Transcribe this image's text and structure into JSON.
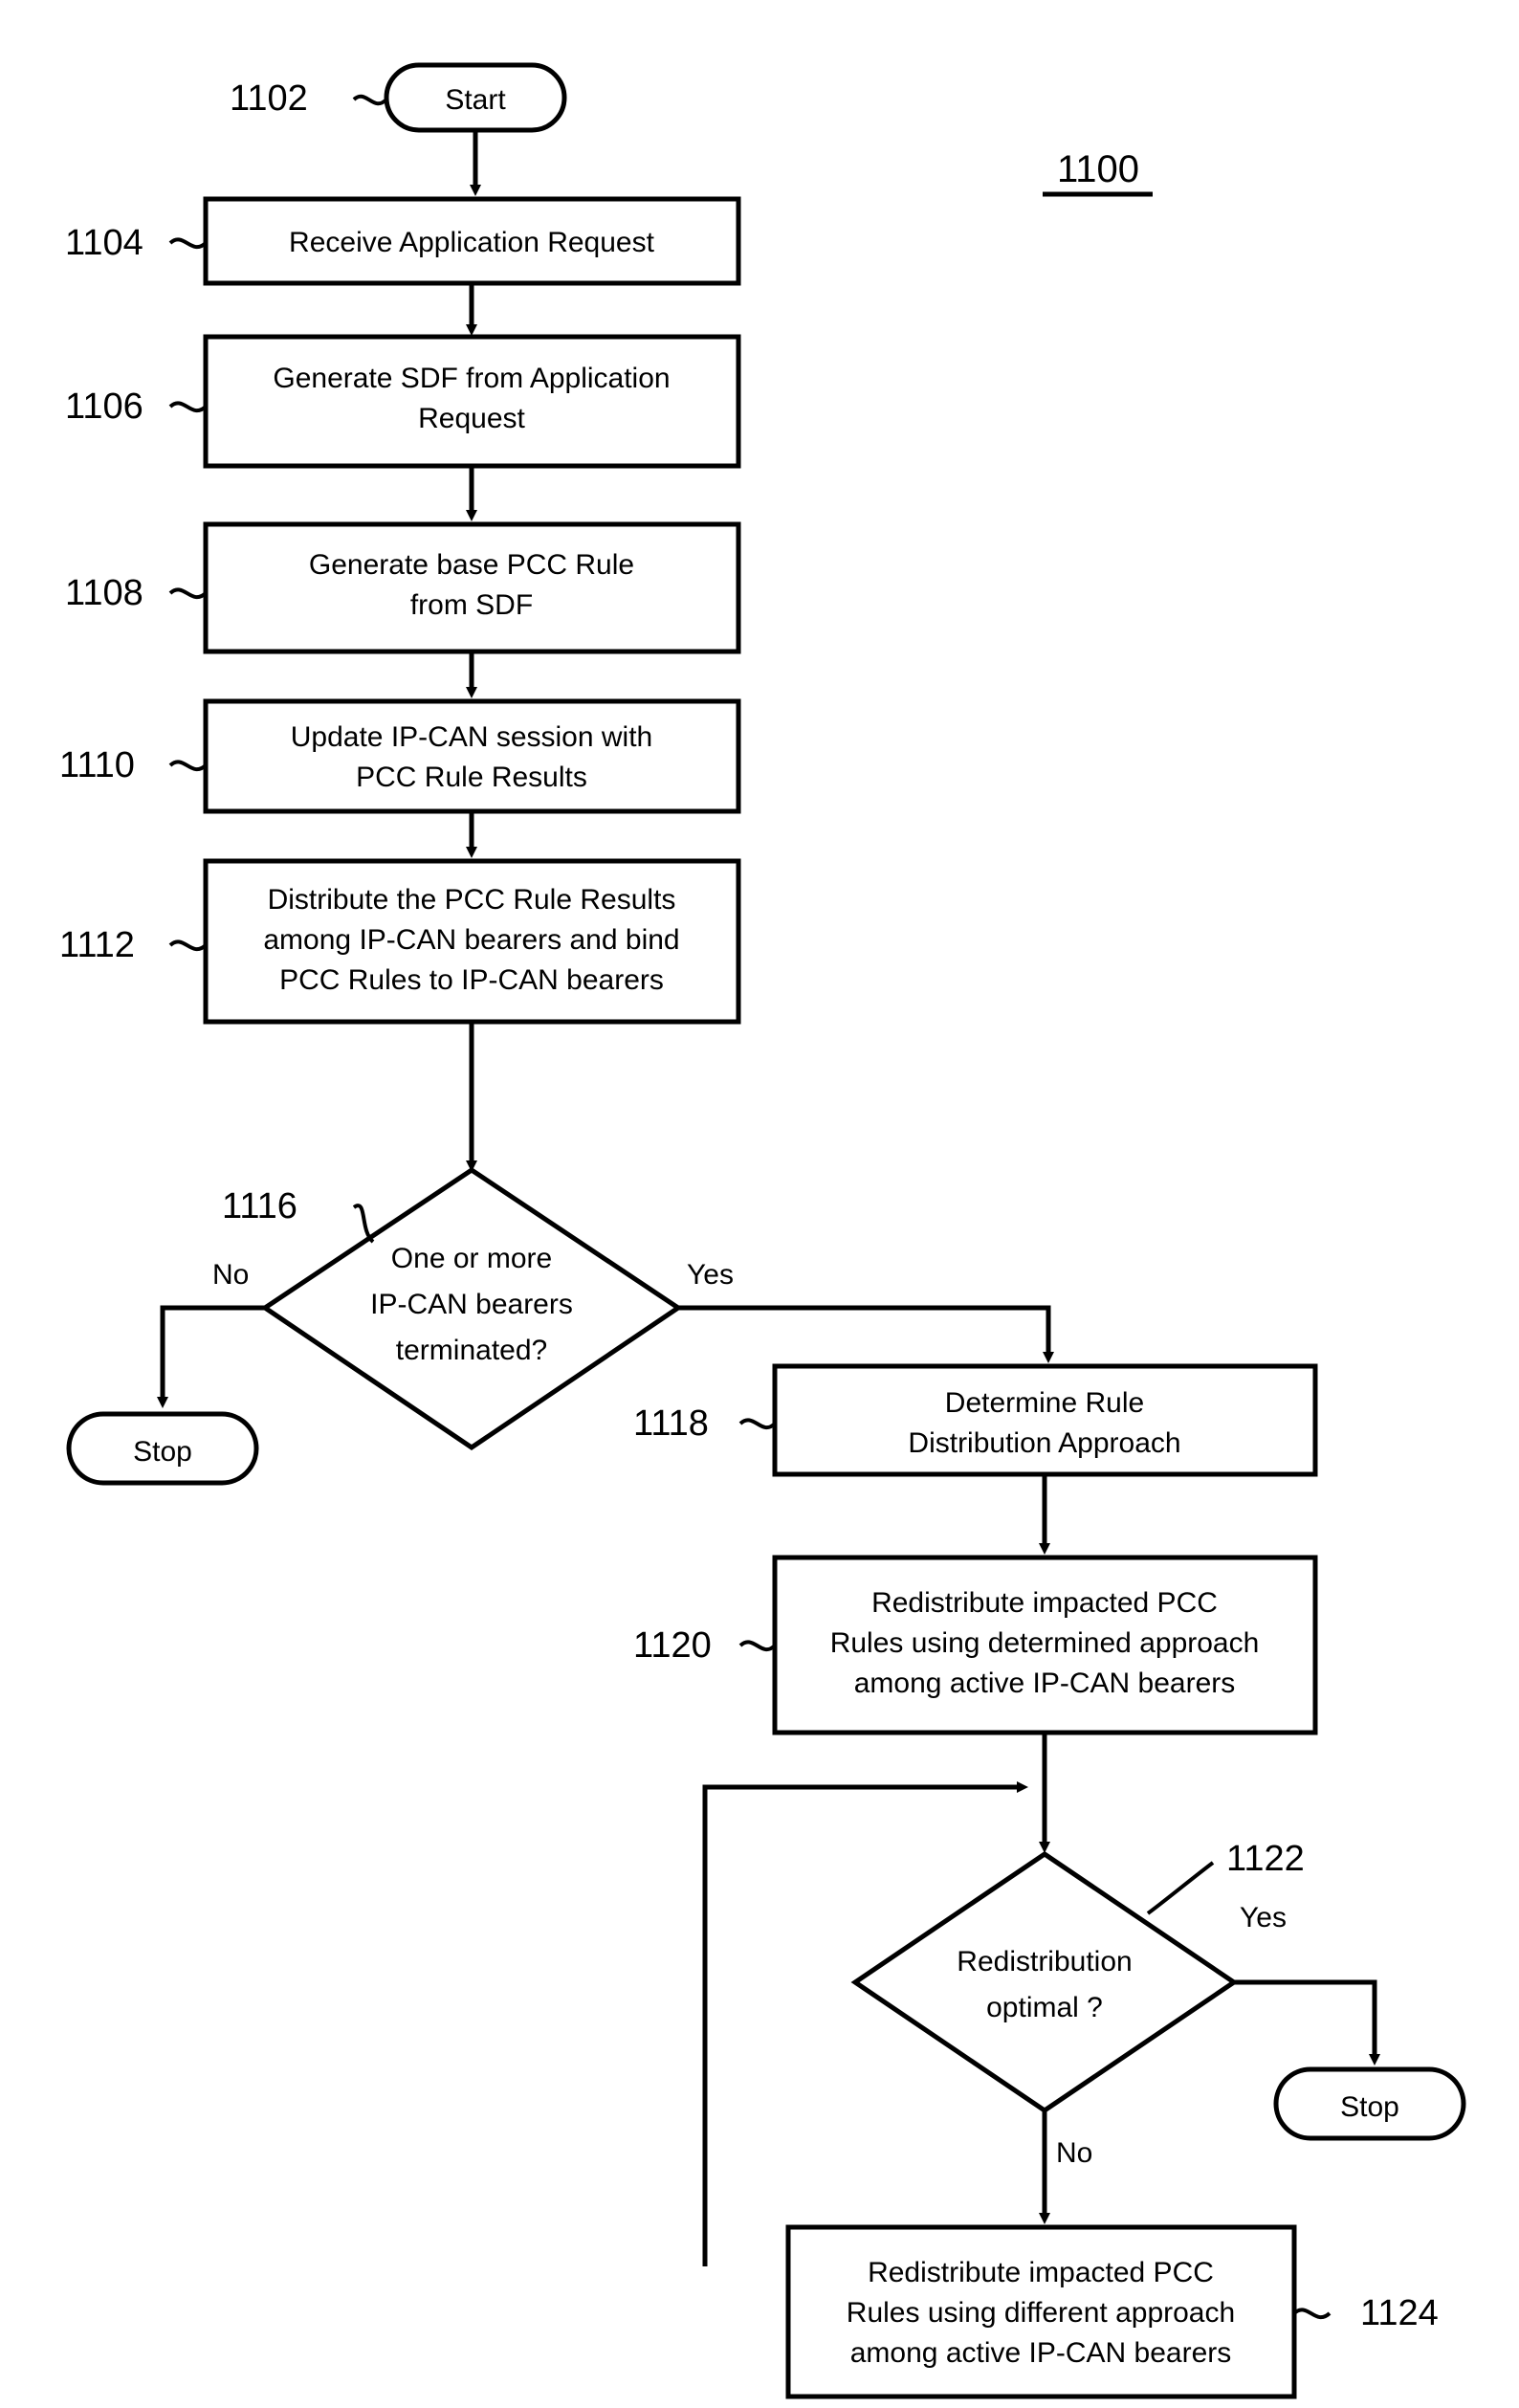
{
  "figure": {
    "title": "1100",
    "title_underlined": true
  },
  "colors": {
    "line": "#000000",
    "fill": "#ffffff",
    "text": "#000000"
  },
  "nodes": [
    {
      "id": "1102",
      "ref": "1102",
      "kind": "terminator",
      "lines": [
        "Start"
      ]
    },
    {
      "id": "1104",
      "ref": "1104",
      "kind": "process",
      "lines": [
        "Receive Application Request"
      ]
    },
    {
      "id": "1106",
      "ref": "1106",
      "kind": "process",
      "lines": [
        "Generate SDF from Application",
        "Request"
      ]
    },
    {
      "id": "1108",
      "ref": "1108",
      "kind": "process",
      "lines": [
        "Generate base PCC Rule",
        "from SDF"
      ]
    },
    {
      "id": "1110",
      "ref": "1110",
      "kind": "process",
      "lines": [
        "Update IP-CAN session with",
        "PCC Rule Results"
      ]
    },
    {
      "id": "1112",
      "ref": "1112",
      "kind": "process",
      "lines": [
        "Distribute the PCC Rule Results",
        "among IP-CAN bearers and bind",
        "PCC Rules to IP-CAN bearers"
      ]
    },
    {
      "id": "1116",
      "ref": "1116",
      "kind": "decision",
      "lines": [
        "One or more",
        "IP-CAN bearers",
        "terminated?"
      ]
    },
    {
      "id": "stop1",
      "ref": "",
      "kind": "terminator",
      "lines": [
        "Stop"
      ]
    },
    {
      "id": "1118",
      "ref": "1118",
      "kind": "process",
      "lines": [
        "Determine Rule",
        "Distribution Approach"
      ]
    },
    {
      "id": "1120",
      "ref": "1120",
      "kind": "process",
      "lines": [
        "Redistribute impacted PCC",
        "Rules using determined approach",
        "among active IP-CAN bearers"
      ]
    },
    {
      "id": "1122",
      "ref": "1122",
      "kind": "decision",
      "lines": [
        "Redistribution",
        "optimal ?"
      ]
    },
    {
      "id": "stop2",
      "ref": "",
      "kind": "terminator",
      "lines": [
        "Stop"
      ]
    },
    {
      "id": "1124",
      "ref": "1124",
      "kind": "process",
      "lines": [
        "Redistribute impacted PCC",
        "Rules using different approach",
        "among active IP-CAN bearers"
      ]
    }
  ],
  "edge_labels": {
    "d1116_no": "No",
    "d1116_yes": "Yes",
    "d1122_yes": "Yes",
    "d1122_no": "No"
  }
}
